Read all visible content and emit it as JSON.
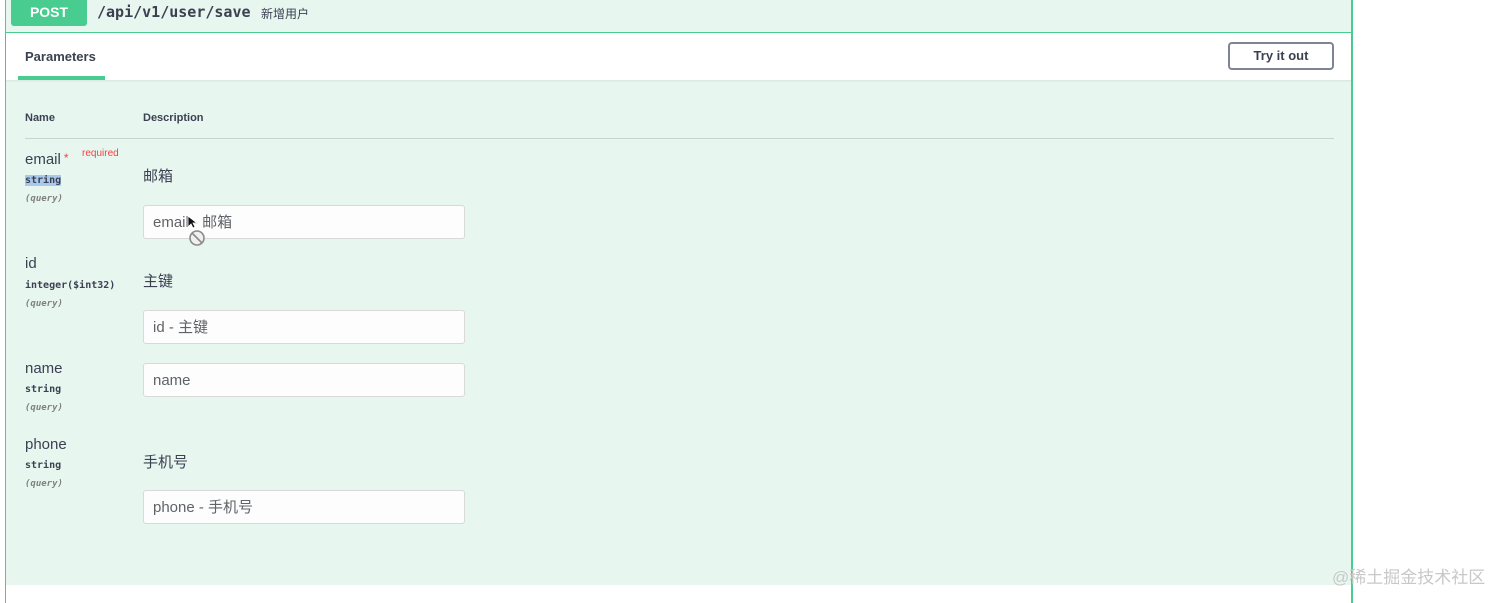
{
  "operation": {
    "method": "POST",
    "path": "/api/v1/user/save",
    "summary": "新增用户",
    "method_color": "#49cc90"
  },
  "tabs": {
    "parameters_label": "Parameters"
  },
  "actions": {
    "try_it_out_label": "Try it out"
  },
  "table": {
    "col_name": "Name",
    "col_description": "Description"
  },
  "params": [
    {
      "name": "email",
      "required_mark": "*",
      "required_label": "required",
      "type": "string",
      "in": "(query)",
      "description": "邮箱",
      "placeholder": "email - 邮箱"
    },
    {
      "name": "id",
      "type": "integer($int32)",
      "in": "(query)",
      "description": "主键",
      "placeholder": "id - 主键"
    },
    {
      "name": "name",
      "type": "string",
      "in": "(query)",
      "description": "",
      "placeholder": "name"
    },
    {
      "name": "phone",
      "type": "string",
      "in": "(query)",
      "description": "手机号",
      "placeholder": "phone - 手机号"
    }
  ],
  "watermark": "@稀土掘金技术社区",
  "icons": {
    "cursor": "pointer-cursor-icon",
    "not_allowed": "not-allowed-icon"
  }
}
